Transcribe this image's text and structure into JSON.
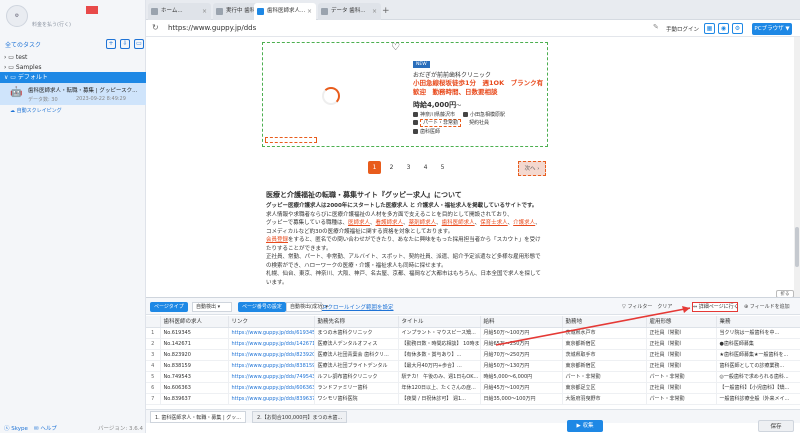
{
  "sidebar": {
    "username": "",
    "tagline": "料金を払う(行く)",
    "tasks_title": "全てのタスク",
    "tree": [
      {
        "label": "test"
      },
      {
        "label": "Samples"
      },
      {
        "label": "デフォルト"
      }
    ],
    "task": {
      "name": "歯科医師求人・転職・募集 | グッピースク...",
      "meta": "データ数: 30",
      "date": "2023-09-22 8:49:29",
      "cloud": "自動スクレイピング"
    },
    "skype": "Skype",
    "helper": "ヘルプ",
    "version": "バージョン: 3.6.4"
  },
  "tabs": [
    {
      "label": "ホーム..."
    },
    {
      "label": "実行中 歯科..."
    },
    {
      "label": "歯科医師求人..."
    },
    {
      "label": "データ 歯科..."
    }
  ],
  "address": {
    "url": "https://www.guppy.jp/dds",
    "manual_login": "手動ログイン",
    "pc_browser": "PCブラウザ ▼"
  },
  "listing": {
    "badge": "NEW",
    "clinic": "おだぎが前前歯科クリニック",
    "job_title": "小田急線桜坂徒歩1分　週1OK　ブランク有歓迎　勤務時間、日数要相談",
    "wage": "時給4,000円",
    "wage_suffix": "〜",
    "location": "神奈川県藤沢市",
    "station": "小田急相模原駅",
    "employment": "パート・非常勤",
    "contract": "契約社員",
    "role": "歯科医師"
  },
  "pager": {
    "pages": [
      "1",
      "2",
      "3",
      "4",
      "5"
    ],
    "next": "次へ ›"
  },
  "about": {
    "title": "医療と介護福祉の転職・募集サイト『グッピー求人』について",
    "p1": "グッピー医療介護求人は2000年にスタートした医療求人 と 介護求人・福祉求人を掲載しているサイトです。",
    "p2": "求人情報や求職者ならびに医療介護福祉の人材を多方面で支えることを目的として開設されており、",
    "p3": "グッピーで募集している職種は、",
    "r1": "医師求人",
    "r2": "看護師求人",
    "r3": "薬剤師求人",
    "r4": "歯科医師求人",
    "r5": "保育士求人",
    "r6": "介護求人",
    "p4": "、コメディカルなど約30の医療介護福祉に関する資格を対象としております。",
    "r7": "会員登録",
    "p5": "をすると、匿名での問い合わせができたり、あなたに興味をもった採用担当者から「スカウト」を受けたりすることができます。",
    "p6": "正社員、常勤、パート、非常勤、アルバイト、スポット、契約社員、派遣、紹介予定派遣など多様な雇用形態での検索ができ、ハローワークの医療・介護・福祉求人も同時に探せます。",
    "p7": "札幌、仙台、東京、神奈川、大阪、神戸、名古屋、京都、福岡など大都市はもちろん、日本全国で求人を探しています。"
  },
  "zoom_out": "折る",
  "data_panel": {
    "type_pill": "ページタイプ",
    "type_select": "自動検出",
    "pager_pill": "ページ番号の設定",
    "pager_select": "自動検出(成功)",
    "scroll_link": "スクロールイング範囲を設定",
    "filter": "フィルター",
    "clear": "クリア",
    "detail_btn": "詳細ページに行く",
    "add_field": "フィールドを追加",
    "headers": [
      "",
      "歯科医師の求人",
      "リンク",
      "勤務先名称",
      "タイトル",
      "給料",
      "勤務地",
      "雇用形態",
      "業務"
    ],
    "rows": [
      [
        "1",
        "No.619345",
        "https://www.guppy.jp/dds/619345",
        "まつの木歯科クリニック",
        "インプラント・マウスピース矯...",
        "月給50万〜100万円",
        "茨城県水戸市",
        "正社員（常勤）",
        "当クリ院は一般歯科を中..."
      ],
      [
        "2",
        "No.142671",
        "https://www.guppy.jp/dds/142671",
        "医療法人デンタルオフィス",
        "【勤務日数・時間応相談】 10時までの...",
        "月給65万〜250万円",
        "東京都新宿区",
        "正社員（常勤）",
        "●歯科医師募集"
      ],
      [
        "3",
        "No.823920",
        "https://www.guppy.jp/dds/823920",
        "医療法人社団青葉会 歯科クリ...",
        "【有休多数・賞与あり】...",
        "月給70万〜250万円",
        "茨城県取手市",
        "正社員（常勤）",
        "★歯科医師募集★一般歯科を..."
      ],
      [
        "4",
        "No.838159",
        "https://www.guppy.jp/dds/838159",
        "医療法人社団ブライトデンタル",
        "【最大月40万円+歩合】...",
        "月給50万〜130万円",
        "東京都新宿区",
        "正社員（常勤）",
        "歯科医師としての診療業務..."
      ],
      [
        "5",
        "No.749543",
        "https://www.guppy.jp/dds/749543",
        "ルフレ調布歯科クリニック",
        "駅チカ！ 午後のみ、週1日もOK...",
        "時給5,000〜6,000円",
        "パート・非常勤",
        "パート・非常勤",
        "◎一般歯科で求められる歯科..."
      ],
      [
        "6",
        "No.606363",
        "https://www.guppy.jp/dds/606363",
        "ランドファミリー歯科",
        "年休120日以上、たくさんの症...",
        "月給45万〜100万円",
        "東京都足立区",
        "正社員（常勤）",
        "【一般歯科】【小児歯科】【矯..."
      ],
      [
        "7",
        "No.839637",
        "https://www.guppy.jp/dds/839637",
        "ワシモリ歯科医院",
        "【夜間 / 日祝休診可】 週1...",
        "日給35,000〜100万円",
        "大阪府羽曳野市",
        "パート・非常勤",
        "一般歯科診療全般（外来メイ..."
      ]
    ],
    "bottom_tabs": [
      {
        "label": "1. 歯科医師求人・転職・募集 | グッ..."
      },
      {
        "label": "2.【お問合100,000円】まつの木歯..."
      }
    ],
    "collect_btn": "▶ 収集",
    "save_btn": "保存"
  },
  "colors": {
    "accent": "#1e88e5",
    "highlight": "#e85c1c",
    "annotation": "#e53935"
  }
}
